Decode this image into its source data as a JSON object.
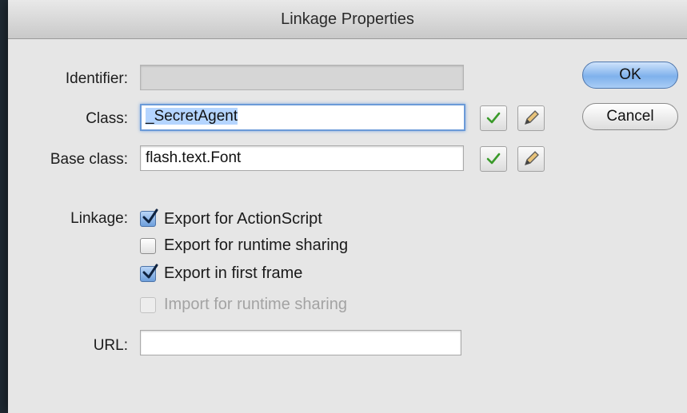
{
  "dialog": {
    "title": "Linkage Properties"
  },
  "fields": {
    "identifier": {
      "label": "Identifier:",
      "value": ""
    },
    "class": {
      "label": "Class:",
      "value": "_SecretAgent"
    },
    "base_class": {
      "label": "Base class:",
      "value": "flash.text.Font"
    },
    "url": {
      "label": "URL:",
      "value": ""
    }
  },
  "buttons": {
    "ok": "OK",
    "cancel": "Cancel"
  },
  "linkage": {
    "label": "Linkage:",
    "options": [
      {
        "label": "Export for ActionScript",
        "checked": true,
        "enabled": true
      },
      {
        "label": "Export for runtime sharing",
        "checked": false,
        "enabled": true
      },
      {
        "label": "Export in first frame",
        "checked": true,
        "enabled": true
      },
      {
        "label": "Import for runtime sharing",
        "checked": false,
        "enabled": false
      }
    ]
  },
  "icons": {
    "validate": "checkmark-icon",
    "edit": "pencil-icon",
    "validate_color": "#3a9a2a"
  }
}
